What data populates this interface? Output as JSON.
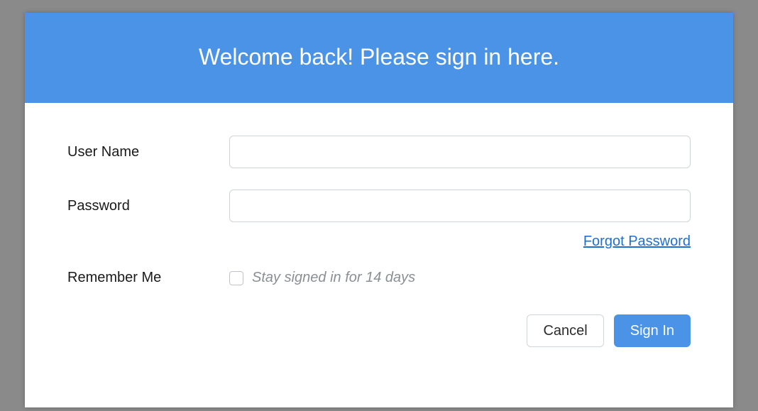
{
  "header": {
    "title": "Welcome back! Please sign in here."
  },
  "form": {
    "username": {
      "label": "User Name",
      "value": ""
    },
    "password": {
      "label": "Password",
      "value": ""
    },
    "forgot_link": "Forgot Password",
    "remember": {
      "label": "Remember Me",
      "checkbox_label": "Stay signed in for 14 days",
      "checked": false
    },
    "cancel_label": "Cancel",
    "submit_label": "Sign In"
  }
}
